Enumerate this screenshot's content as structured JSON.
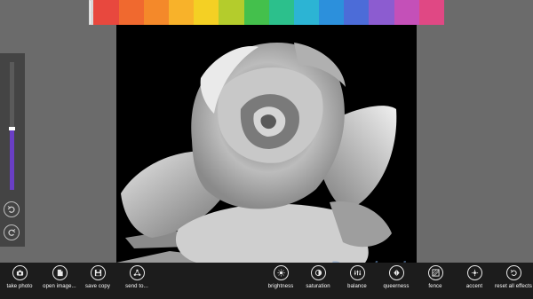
{
  "colors": {
    "swatches": [
      "#e8483e",
      "#f0692f",
      "#f4892a",
      "#f8b22a",
      "#f4d024",
      "#b4cc2c",
      "#44c04c",
      "#2cc08c",
      "#2cb4d4",
      "#2c90dc",
      "#4c6cd8",
      "#8c5cd0",
      "#c450b8",
      "#e04884"
    ],
    "slider_fill": "#6a3fc4",
    "appbar_bg": "#1c1c1c"
  },
  "slider": {
    "level": 0.48
  },
  "left_buttons": {
    "undo_icon": "undo-icon",
    "redo_icon": "redo-icon"
  },
  "commands_left": [
    {
      "label": "take photo",
      "icon": "camera-icon"
    },
    {
      "label": "open image...",
      "icon": "open-file-icon"
    },
    {
      "label": "save copy",
      "icon": "save-icon"
    },
    {
      "label": "send to...",
      "icon": "share-icon"
    }
  ],
  "commands_right": [
    {
      "label": "brightness",
      "icon": "brightness-icon"
    },
    {
      "label": "saturation",
      "icon": "saturation-icon"
    },
    {
      "label": "balance",
      "icon": "balance-icon"
    },
    {
      "label": "queerness",
      "icon": "queerness-icon"
    },
    {
      "label": "fence",
      "icon": "fence-icon"
    },
    {
      "label": "accent",
      "icon": "accent-icon"
    },
    {
      "label": "reset all effects",
      "icon": "reset-icon"
    }
  ],
  "watermark": "Download"
}
